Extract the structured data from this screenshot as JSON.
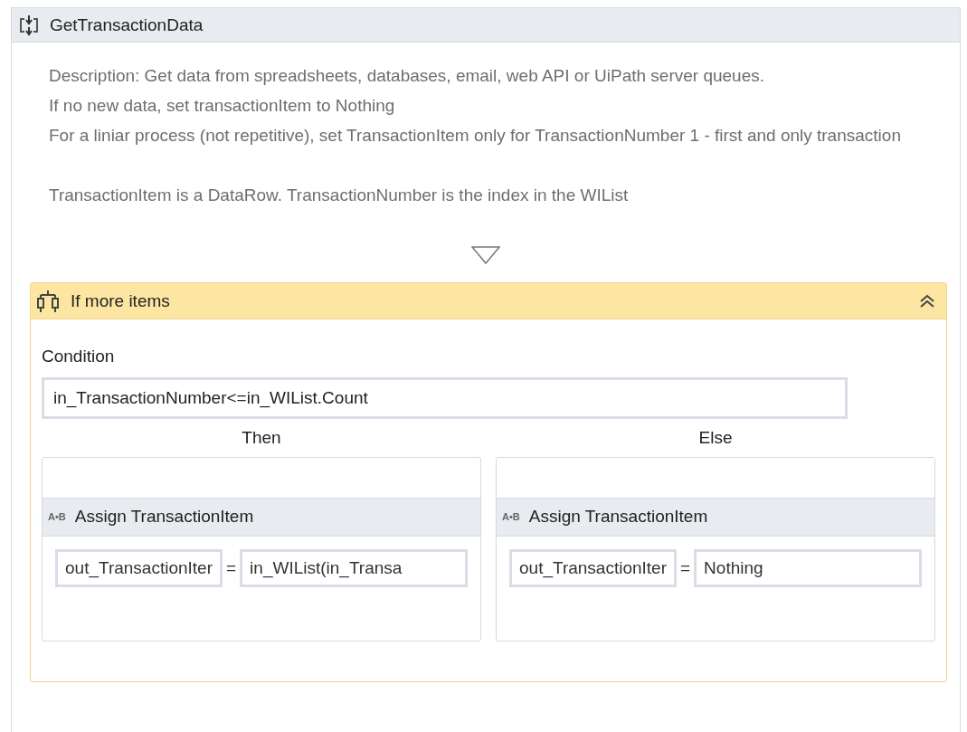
{
  "sequence": {
    "title": "GetTransactionData",
    "description": [
      [
        "Description: Get data from spreadsheets, databases, email, web API or UiPath server queues.",
        "If no new data, set transactionItem to Nothing",
        "For a liniar process (not repetitive), set TransactionItem only for TransactionNumber 1 - first and only transaction"
      ],
      [
        "TransactionItem is a DataRow. TransactionNumber is the index in the WIList"
      ]
    ],
    "if_activity": {
      "title": "If more items",
      "expanded": true,
      "condition_label": "Condition",
      "condition": "in_TransactionNumber<=in_WIList.Count",
      "branches": [
        {
          "label": "Then",
          "assign": {
            "icon_text": "A•B",
            "title": "Assign TransactionItem",
            "to": "out_TransactionIter",
            "operator": "=",
            "value": "in_WIList(in_Transa"
          }
        },
        {
          "label": "Else",
          "assign": {
            "icon_text": "A•B",
            "title": "Assign TransactionItem",
            "to": "out_TransactionIter",
            "operator": "=",
            "value": "Nothing"
          }
        }
      ]
    }
  }
}
